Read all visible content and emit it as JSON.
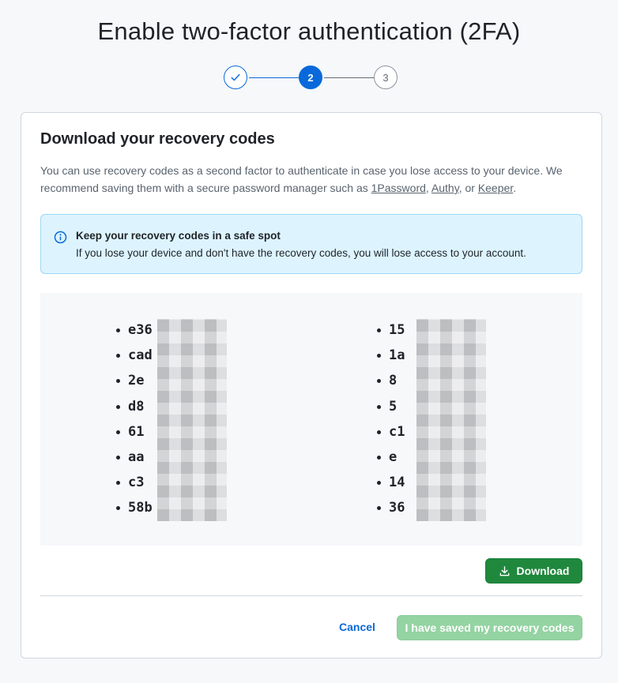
{
  "page": {
    "title": "Enable two-factor authentication (2FA)"
  },
  "stepper": {
    "steps": [
      {
        "label": "✓",
        "state": "complete"
      },
      {
        "label": "2",
        "state": "current"
      },
      {
        "label": "3",
        "state": "upcoming"
      }
    ]
  },
  "card": {
    "title": "Download your recovery codes",
    "description_prefix": "You can use recovery codes as a second factor to authenticate in case you lose access to your device. We recommend saving them with a secure password manager such as ",
    "links": [
      "1Password",
      "Authy",
      "Keeper"
    ],
    "sep1": ", ",
    "sep2": ", or ",
    "description_suffix": "."
  },
  "notice": {
    "icon": "info-icon",
    "title": "Keep your recovery codes in a safe spot",
    "body": "If you lose your device and don't have the recovery codes, you will lose access to your account."
  },
  "codes": {
    "left": [
      "e36",
      "cad",
      "2e",
      "d8",
      "61",
      "aa",
      "c3",
      "58b"
    ],
    "right": [
      "15",
      "1a",
      "8",
      "5",
      "c1",
      "e",
      "14",
      "36"
    ]
  },
  "actions": {
    "download_label": "Download",
    "download_icon": "download-icon",
    "cancel_label": "Cancel",
    "saved_label": "I have saved my recovery codes"
  },
  "colors": {
    "accent": "#0969da",
    "primary_button": "#1f883d",
    "disabled_primary_button": "#94d3a2",
    "notice_background": "#ddf4ff"
  }
}
